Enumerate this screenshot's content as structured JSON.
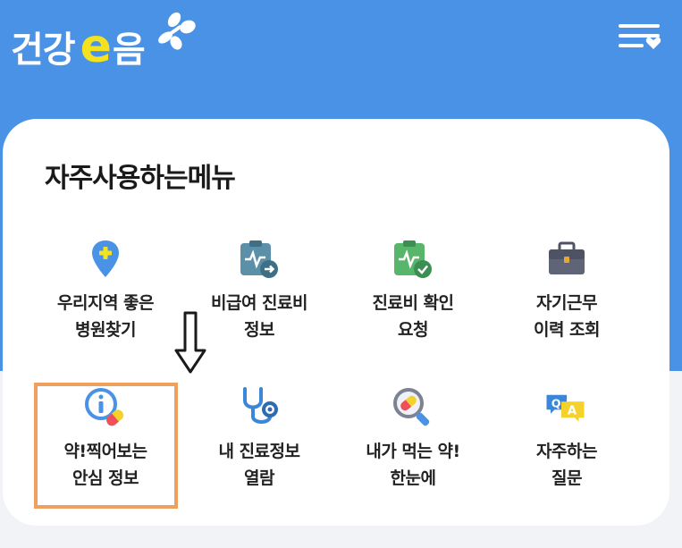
{
  "header": {
    "logo_prefix": "건강",
    "logo_e": "e",
    "logo_suffix": "음",
    "menu_icon": "hamburger-heart-icon",
    "background_color": "#4a92e6"
  },
  "main": {
    "title": "자주사용하는메뉴",
    "items": [
      {
        "line1": "우리지역 좋은",
        "line2": "병원찾기",
        "icon": "location-pin-plus-icon"
      },
      {
        "line1": "비급여 진료비",
        "line2": "정보",
        "icon": "clipboard-arrow-icon"
      },
      {
        "line1": "진료비 확인",
        "line2": "요청",
        "icon": "clipboard-check-icon"
      },
      {
        "line1": "자기근무",
        "line2": "이력 조회",
        "icon": "briefcase-icon"
      },
      {
        "line1": "약!찍어보는",
        "line2": "안심 정보",
        "icon": "info-pill-icon"
      },
      {
        "line1": "내 진료정보",
        "line2": "열람",
        "icon": "stethoscope-icon"
      },
      {
        "line1": "내가 먹는 약!",
        "line2": "한눈에",
        "icon": "magnifier-pill-icon"
      },
      {
        "line1": "자주하는",
        "line2": "질문",
        "icon": "qa-bubbles-icon"
      }
    ]
  },
  "annotation": {
    "highlight_color": "#f0a05e",
    "arrow_icon": "down-arrow-icon"
  }
}
